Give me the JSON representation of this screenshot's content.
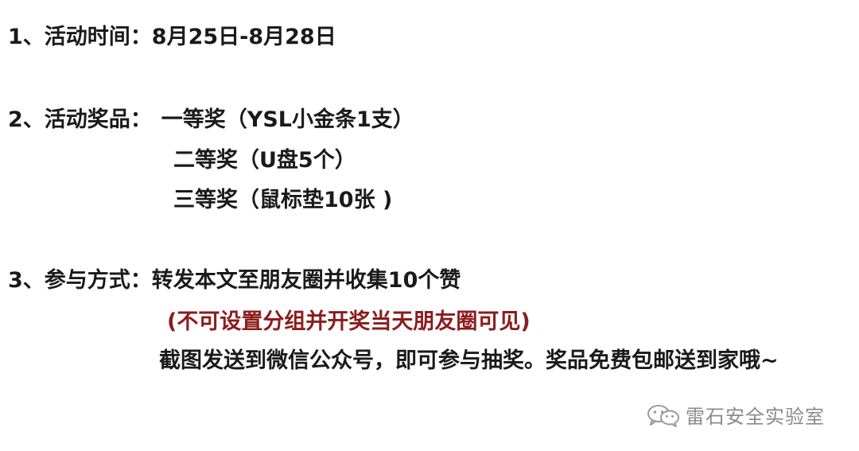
{
  "item1": {
    "label": "1、活动时间：",
    "value": "8月25日-8月28日"
  },
  "item2": {
    "label": "2、活动奖品：",
    "prizes": [
      "一等奖（YSL小金条1支）",
      "二等奖（U盘5个）",
      "三等奖（鼠标垫10张 )"
    ]
  },
  "item3": {
    "label": "3、参与方式：",
    "line1": "转发本文至朋友圈并收集10个赞",
    "note": "(不可设置分组并开奖当天朋友圈可见)",
    "line2": "截图发送到微信公众号，即可参与抽奖。奖品免费包邮送到家哦~"
  },
  "watermark": {
    "icon": "wechat-icon",
    "text": "雷石安全实验室",
    "color": "#8a8a8a"
  },
  "colors": {
    "text": "#1a1a1a",
    "note": "#8b1c1c"
  }
}
